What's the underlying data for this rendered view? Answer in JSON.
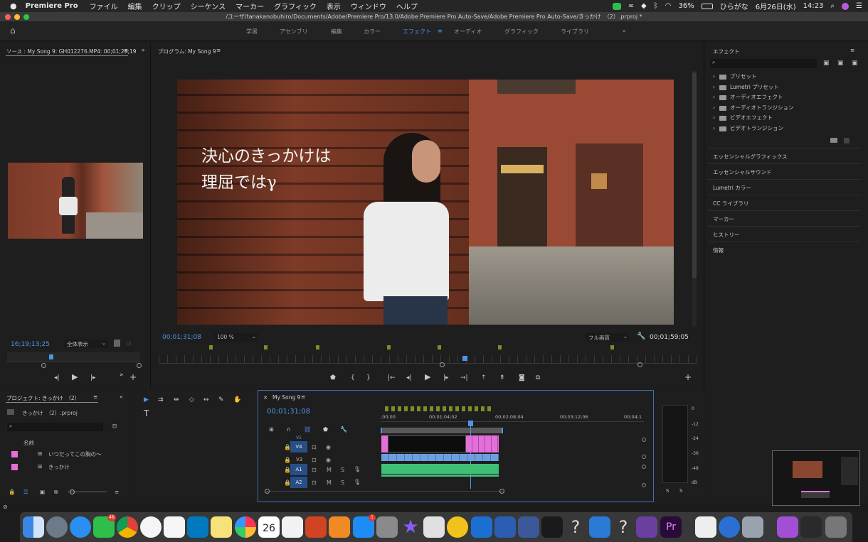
{
  "menubar": {
    "apple": "",
    "app_name": "Premiere Pro",
    "items": [
      "ファイル",
      "編集",
      "クリップ",
      "シーケンス",
      "マーカー",
      "グラフィック",
      "表示",
      "ウィンドウ",
      "ヘルプ"
    ],
    "battery": "36%",
    "input_mode": "ひらがな",
    "date": "6月26日(水)",
    "time": "14:23"
  },
  "titlebar": {
    "path": "/ユーザ/tanakanobuhiro/Documents/Adobe/Premiere Pro/13.0/Adobe Premiere Pro Auto-Save/Adobe Premiere Pro Auto-Save/きっかけ　（2）.prproj *"
  },
  "workspaces": {
    "items": [
      "学習",
      "アセンブリ",
      "編集",
      "カラー",
      "エフェクト",
      "オーディオ",
      "グラフィック",
      "ライブラリ"
    ],
    "active": "エフェクト",
    "more": "»"
  },
  "source": {
    "title": "ソース : My Song 9: GH012276.MP4: 00;01;26;19",
    "menu": "≡",
    "timecode": "16;19;13;25",
    "zoom": "全体表示"
  },
  "program": {
    "title": "プログラム: My Song 9",
    "menu": "≡",
    "timecode_left": "00;01;31;08",
    "zoom": "100 %",
    "quality": "フル画質",
    "timecode_right": "00;01;59;05",
    "overlay_line1": "決心のきっかけは",
    "overlay_line2": "理屈ではγ"
  },
  "effects": {
    "title": "エフェクト",
    "menu": "≡",
    "tree": [
      "プリセット",
      "Lumetri プリセット",
      "オーディオエフェクト",
      "オーディオトランジション",
      "ビデオエフェクト",
      "ビデオトランジション"
    ],
    "sections": [
      "エッセンシャルグラフィックス",
      "エッセンシャルサウンド",
      "Lumetri カラー",
      "CC ライブラリ",
      "マーカー",
      "ヒストリー",
      "情報"
    ]
  },
  "project": {
    "title": "プロジェクト: きっかけ　（2）",
    "menu": "≡",
    "file": "きっかけ　（2）.prproj",
    "column": "名前",
    "items": [
      "いつだってこの胸の〜",
      "きっかけ"
    ]
  },
  "timeline": {
    "close": "×",
    "tab": "My Song 9",
    "menu": "≡",
    "timecode": "00;01;31;08",
    "ruler": [
      ";00;00",
      "00;01;04;02",
      "00;02;08;04",
      "00;03;12;06",
      "00;04;1"
    ],
    "tracks": [
      {
        "name": "V4",
        "lock": "🔒"
      },
      {
        "name": "V3",
        "lock": "🔒"
      },
      {
        "name": "A1",
        "lock": "🔒",
        "m": "M",
        "s": "S"
      },
      {
        "name": "A2",
        "lock": "🔒",
        "m": "M",
        "s": "S"
      }
    ],
    "partial_track": "V5"
  },
  "audio_meter": {
    "scale": [
      "0",
      "-12",
      "-24",
      "-36",
      "-48",
      "dB"
    ],
    "solo_labels": [
      "S",
      "S"
    ]
  },
  "dock": {
    "line_badge": "46",
    "appstore_badge": "1",
    "calendar_day": "26"
  },
  "colors": {
    "accent_blue": "#4f95ee",
    "clip_pink": "#e36fd8",
    "clip_blue": "#6d9ee0",
    "clip_green": "#3fbf76",
    "track_button": "#274f86"
  }
}
